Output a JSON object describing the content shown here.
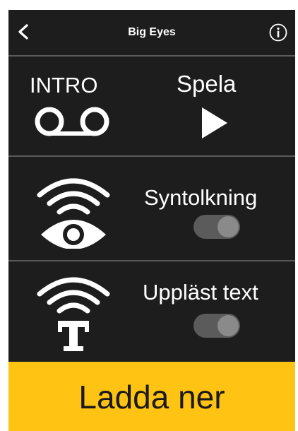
{
  "navbar": {
    "title": "Big Eyes",
    "back_icon": "chevron-left-icon",
    "info_icon": "info-circle-icon"
  },
  "intro": {
    "label": "INTRO",
    "icon": "cassette-tape-icon",
    "play_label": "Spela",
    "play_icon": "play-triangle-icon"
  },
  "audio_description": {
    "label": "Syntolkning",
    "icon": "wifi-eye-icon",
    "toggle_state": "off"
  },
  "read_text": {
    "label": "Uppläst text",
    "icon": "wifi-text-icon",
    "toggle_state": "off"
  },
  "download": {
    "label": "Ladda ner"
  },
  "colors": {
    "background": "#1d1d1d",
    "accent": "#ffc313",
    "divider": "#5a5a5a"
  }
}
